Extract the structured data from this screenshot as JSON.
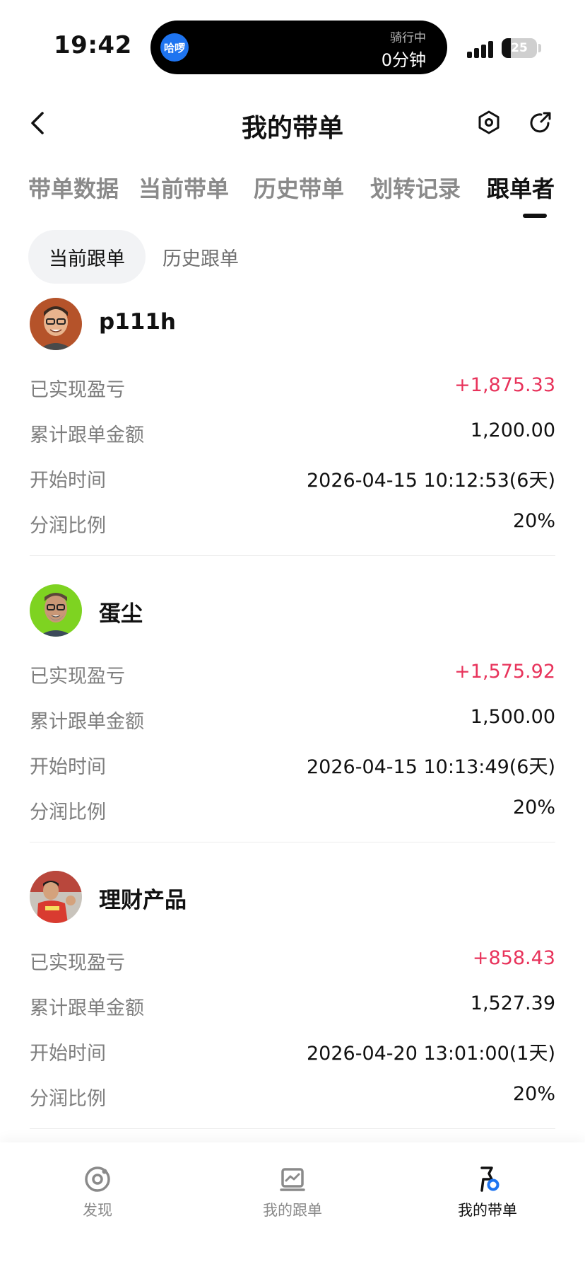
{
  "status_bar": {
    "time": "19:42",
    "island_app_icon": "哈啰",
    "island_status": "骑行中",
    "island_duration": "0分钟",
    "battery_level": 25,
    "battery_label": "25"
  },
  "header": {
    "title": "我的带单",
    "back_icon": "chevron-left-icon",
    "settings_icon": "hexagon-settings-icon",
    "share_icon": "share-arrow-icon"
  },
  "tabs": [
    {
      "label": "带单数据"
    },
    {
      "label": "当前带单"
    },
    {
      "label": "历史带单"
    },
    {
      "label": "划转记录"
    },
    {
      "label": "跟单者",
      "active": true
    }
  ],
  "sub_tabs": [
    {
      "label": "当前跟单",
      "active": true
    },
    {
      "label": "历史跟单"
    }
  ],
  "field_labels": {
    "pnl": "已实现盈亏",
    "total": "累计跟单金额",
    "start": "开始时间",
    "share": "分润比例"
  },
  "followers": [
    {
      "name": "p111h",
      "pnl": "+1,875.33",
      "total": "1,200.00",
      "start": "2026-04-15 10:12:53(6天)",
      "share": "20%"
    },
    {
      "name": "蛋尘",
      "pnl": "+1,575.92",
      "total": "1,500.00",
      "start": "2026-04-15 10:13:49(6天)",
      "share": "20%"
    },
    {
      "name": "理财产品",
      "pnl": "+858.43",
      "total": "1,527.39",
      "start": "2026-04-20 13:01:00(1天)",
      "share": "20%"
    }
  ],
  "bottom_nav": [
    {
      "label": "发现",
      "icon": "discover-icon"
    },
    {
      "label": "我的跟单",
      "icon": "chart-board-icon"
    },
    {
      "label": "我的带单",
      "icon": "flag-badge-icon",
      "active": true
    }
  ],
  "colors": {
    "positive": "#e8335b",
    "text_primary": "#111111",
    "text_secondary": "#7e7e7e",
    "accent_blue": "#1e74f0"
  }
}
